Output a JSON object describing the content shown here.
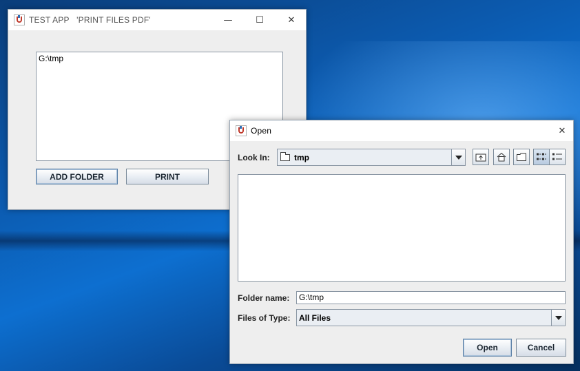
{
  "main_window": {
    "title": "TEST APP   'PRINT FILES PDF'",
    "minimize": "—",
    "maximize": "☐",
    "close": "✕",
    "textarea_value": "G:\\tmp",
    "add_folder_label": "ADD FOLDER",
    "print_label": "PRINT"
  },
  "dialog": {
    "title": "Open",
    "close": "✕",
    "look_in_label": "Look In:",
    "look_in_value": "tmp",
    "folder_name_label": "Folder name:",
    "folder_name_value": "G:\\tmp",
    "files_of_type_label": "Files of Type:",
    "files_of_type_value": "All Files",
    "open_label": "Open",
    "cancel_label": "Cancel",
    "toolbar_icons": [
      "up-one-level-icon",
      "home-icon",
      "new-folder-icon",
      "list-view-icon",
      "details-view-icon"
    ]
  }
}
